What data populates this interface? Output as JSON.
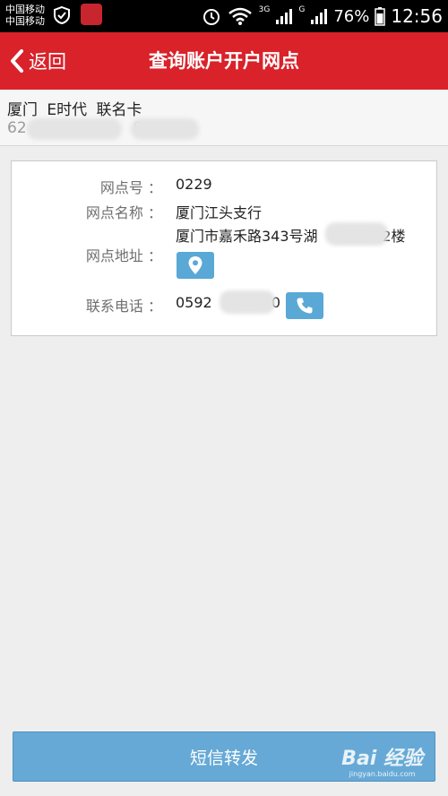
{
  "status_bar": {
    "carrier_1": "中国移动",
    "carrier_2": "中国移动",
    "network_1": "3G",
    "network_2": "G",
    "battery": "76%",
    "time": "12:56"
  },
  "header": {
    "back_label": "返回",
    "title": "查询账户开户网点",
    "background": "#d9222a"
  },
  "account": {
    "card_name": "厦门  E时代  联名卡",
    "number_prefix": "62",
    "number_fragment": "0"
  },
  "branch": {
    "number_label": "网点号 ：",
    "number_value": "0229",
    "name_label": "网点名称 ：",
    "name_value": "厦门江头支行",
    "address_label": "网点地址 ：",
    "address_prefix": "厦门市嘉禾路343号湖",
    "address_suffix": "-2楼",
    "phone_label": "联系电话 ：",
    "phone_prefix": "0592",
    "phone_suffix": "80"
  },
  "footer": {
    "sms_button": "短信转发",
    "button_color": "#66a9d6"
  },
  "watermark": {
    "main": "Bai  经验",
    "sub": "jingyan.baidu.com"
  }
}
